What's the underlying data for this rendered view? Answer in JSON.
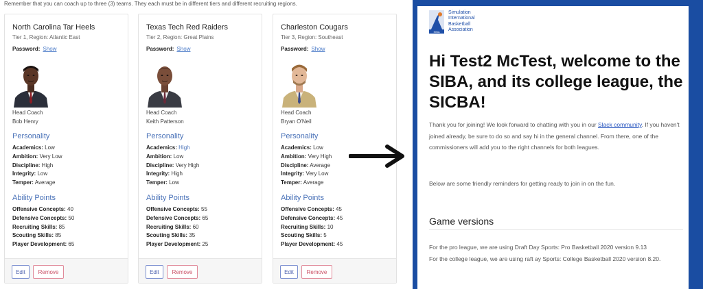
{
  "notice": "Remember that you can coach up to three (3) teams. They each must be in different tiers and different recruiting regions.",
  "labels": {
    "password": "Password:",
    "show": "Show",
    "head_coach": "Head Coach",
    "personality_title": "Personality",
    "ability_title": "Ability Points",
    "academics": "Academics:",
    "ambition": "Ambition:",
    "discipline": "Discipline:",
    "integrity": "Integrity:",
    "temper": "Temper:",
    "offensive": "Offensive Concepts:",
    "defensive": "Defensive Concepts:",
    "recruiting": "Recruiting Skills:",
    "scouting": "Scouting Skills:",
    "player_dev": "Player Development:",
    "edit": "Edit",
    "remove": "Remove"
  },
  "cards": [
    {
      "team": "North Carolina Tar Heels",
      "tier": "Tier 1, Region: Atlantic East",
      "coach": "Bob Henry",
      "personality": {
        "academics": "Low",
        "ambition": "Very Low",
        "discipline": "High",
        "integrity": "Low",
        "temper": "Average"
      },
      "ability": {
        "offensive": "40",
        "defensive": "50",
        "recruiting": "85",
        "scouting": "85",
        "player_dev": "65"
      }
    },
    {
      "team": "Texas Tech Red Raiders",
      "tier": "Tier 2, Region: Great Plains",
      "coach": "Keith Patterson",
      "personality": {
        "academics": "High",
        "ambition": "Low",
        "discipline": "Very High",
        "integrity": "High",
        "temper": "Low"
      },
      "ability": {
        "offensive": "55",
        "defensive": "65",
        "recruiting": "60",
        "scouting": "35",
        "player_dev": "25"
      }
    },
    {
      "team": "Charleston Cougars",
      "tier": "Tier 3, Region: Southeast",
      "coach": "Bryan O'Neil",
      "personality": {
        "academics": "Low",
        "ambition": "Very High",
        "discipline": "Average",
        "integrity": "Very Low",
        "temper": "Average"
      },
      "ability": {
        "offensive": "45",
        "defensive": "45",
        "recruiting": "10",
        "scouting": "5",
        "player_dev": "45"
      }
    }
  ],
  "email": {
    "logo_lines": [
      "Simulation",
      "International",
      "Basketball",
      "Association"
    ],
    "logo_mark_text": "SIBA",
    "heading": "Hi Test2 McTest, welcome to the SIBA, and its college league, the SICBA!",
    "p1_a": "Thank you for joining! We look forward to chatting with you in our ",
    "p1_link": "Slack community",
    "p1_b": ". If you haven't joined already, be sure to do so and say hi in the general channel. From there, one of the commissioners will add you to the right channels for both leagues.",
    "p2": "Below are some friendly reminders for getting ready to join in on the fun.",
    "section_title": "Game versions",
    "p3_line1": "For the pro league, we are using Draft Day Sports: Pro Basketball 2020 version 9.13",
    "p3_line2": "For the college league, we are using raft ay Sports: College Basketball 2020 version 8.20."
  },
  "colors": {
    "accent_blue": "#4a72b8",
    "email_border": "#1a4da2",
    "edit_border": "#7b8fd0",
    "remove_border": "#e08a9a"
  },
  "icons": {
    "arrow": "right-arrow-icon",
    "logo": "siba-logo-icon",
    "portrait": "coach-portrait"
  }
}
